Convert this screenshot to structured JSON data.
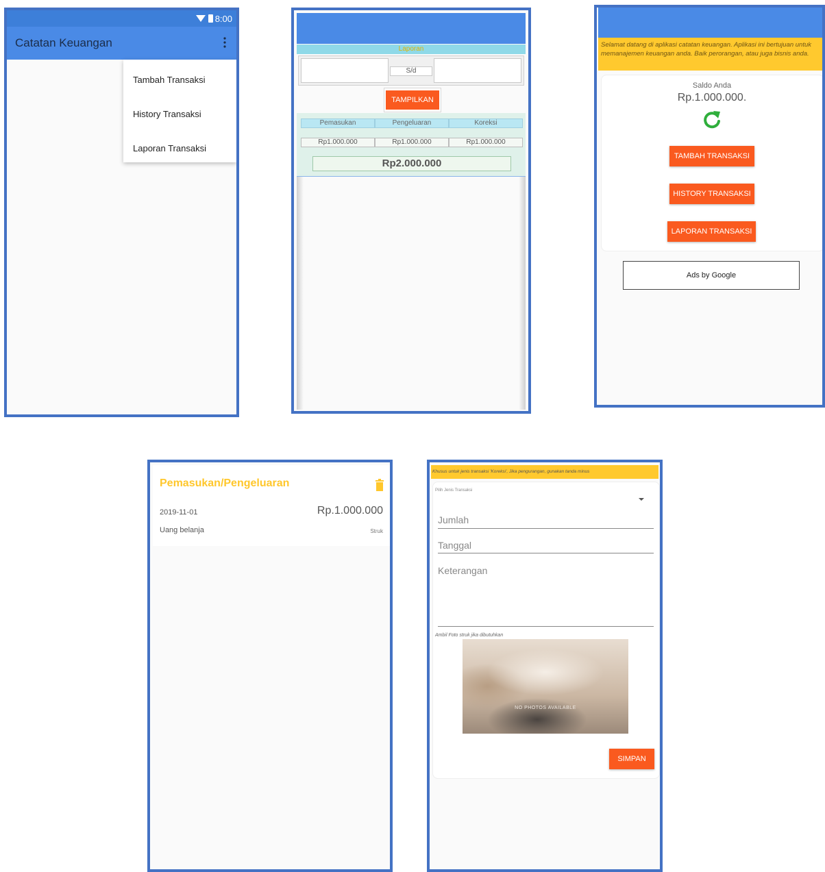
{
  "colors": {
    "frame": "#4472c4",
    "appbar": "#4a8ae6",
    "accent_button": "#fa5a1f",
    "yellow_banner": "#ffc92e",
    "title_yellow": "#ffc72c",
    "refresh_green": "#2fae3c"
  },
  "screen_menu": {
    "status_time": "8:00",
    "app_title": "Catatan Keuangan",
    "overflow_icon": "more-vert-icon",
    "menu_items": [
      "Tambah Transaksi",
      "History Transaksi",
      "Laporan Transaksi"
    ]
  },
  "screen_report": {
    "title": "Laporan",
    "separator": "S/d",
    "show_button": "TAMPILKAN",
    "headers": [
      "Pemasukan",
      "Pengeluaran",
      "Koreksi"
    ],
    "values": [
      "Rp1.000.000",
      "Rp1.000.000",
      "Rp1.000.000"
    ],
    "total": "Rp2.000.000"
  },
  "screen_home": {
    "welcome": "Selamat datang di aplikasi catatan keuangan. Aplikasi ini bertujuan untuk memanajemen keuangan anda. Baik perorangan, atau juga bisnis anda.",
    "saldo_label": "Saldo Anda",
    "saldo_value": "Rp.1.000.000.",
    "refresh_icon": "refresh-icon",
    "buttons": [
      "TAMBAH TRANSAKSI",
      "HISTORY TRANSAKSI",
      "LAPORAN TRANSAKSI"
    ],
    "ads": "Ads by Google"
  },
  "screen_history": {
    "title": "Pemasukan/Pengeluaran",
    "delete_icon": "trash-icon",
    "date": "2019-11-01",
    "amount": "Rp.1.000.000",
    "description": "Uang belanja",
    "attachment": "Struk"
  },
  "screen_form": {
    "note": "Khusus untuk jenis transaksi 'Koreksi', Jika pengurangan, gunakan tanda minus",
    "type_label": "Pilih Jenis Transaksi",
    "field_jumlah": "Jumlah",
    "field_tanggal": "Tanggal",
    "field_keterangan": "Keterangan",
    "photo_label": "Ambil Foto struk jika dibutuhkan",
    "no_photo": "NO PHOTOS AVAILABLE",
    "save_button": "SIMPAN"
  }
}
